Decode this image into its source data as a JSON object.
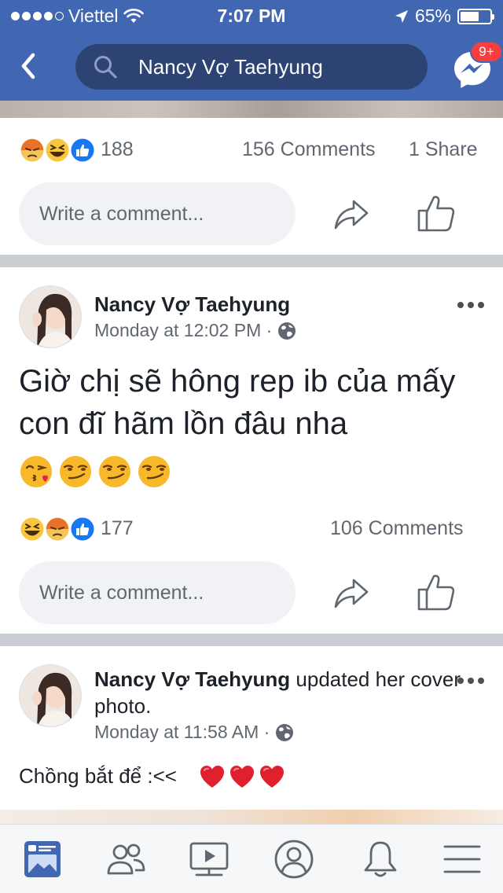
{
  "status_bar": {
    "carrier": "Viettel",
    "time": "7:07 PM",
    "battery_percent": "65%",
    "battery_level": 0.65,
    "signal_bars_filled": 4,
    "signal_bars_total": 5
  },
  "header": {
    "search_text": "Nancy Vợ Taehyung",
    "messenger_badge": "9+"
  },
  "post1_footer": {
    "reaction_count": "188",
    "comments": "156 Comments",
    "shares": "1 Share",
    "comment_placeholder": "Write a comment..."
  },
  "post2": {
    "author": "Nancy Vợ Taehyung",
    "timestamp": "Monday at 12:02 PM · ",
    "text": "Giờ chị sẽ hông rep ib của mấy con đĩ hãm lồn đâu nha",
    "emojis": [
      "kissing-heart",
      "smirk",
      "smirk",
      "smirk"
    ],
    "reaction_count": "177",
    "comments": "106 Comments",
    "comment_placeholder": "Write a comment..."
  },
  "post3": {
    "author": "Nancy Vợ Taehyung",
    "action": " updated her cover photo.",
    "timestamp": "Monday at 11:58 AM · ",
    "text": "Chồng bắt để :<<",
    "emojis": [
      "heart",
      "heart",
      "heart"
    ]
  },
  "bottom_nav": [
    "news-feed",
    "friends",
    "watch",
    "profile",
    "notifications",
    "menu"
  ],
  "colors": {
    "brand": "#4267b2",
    "search_bg": "#2d4373",
    "badge": "#fa3e3e",
    "like_blue": "#1877f2",
    "grey_text": "#606770"
  }
}
